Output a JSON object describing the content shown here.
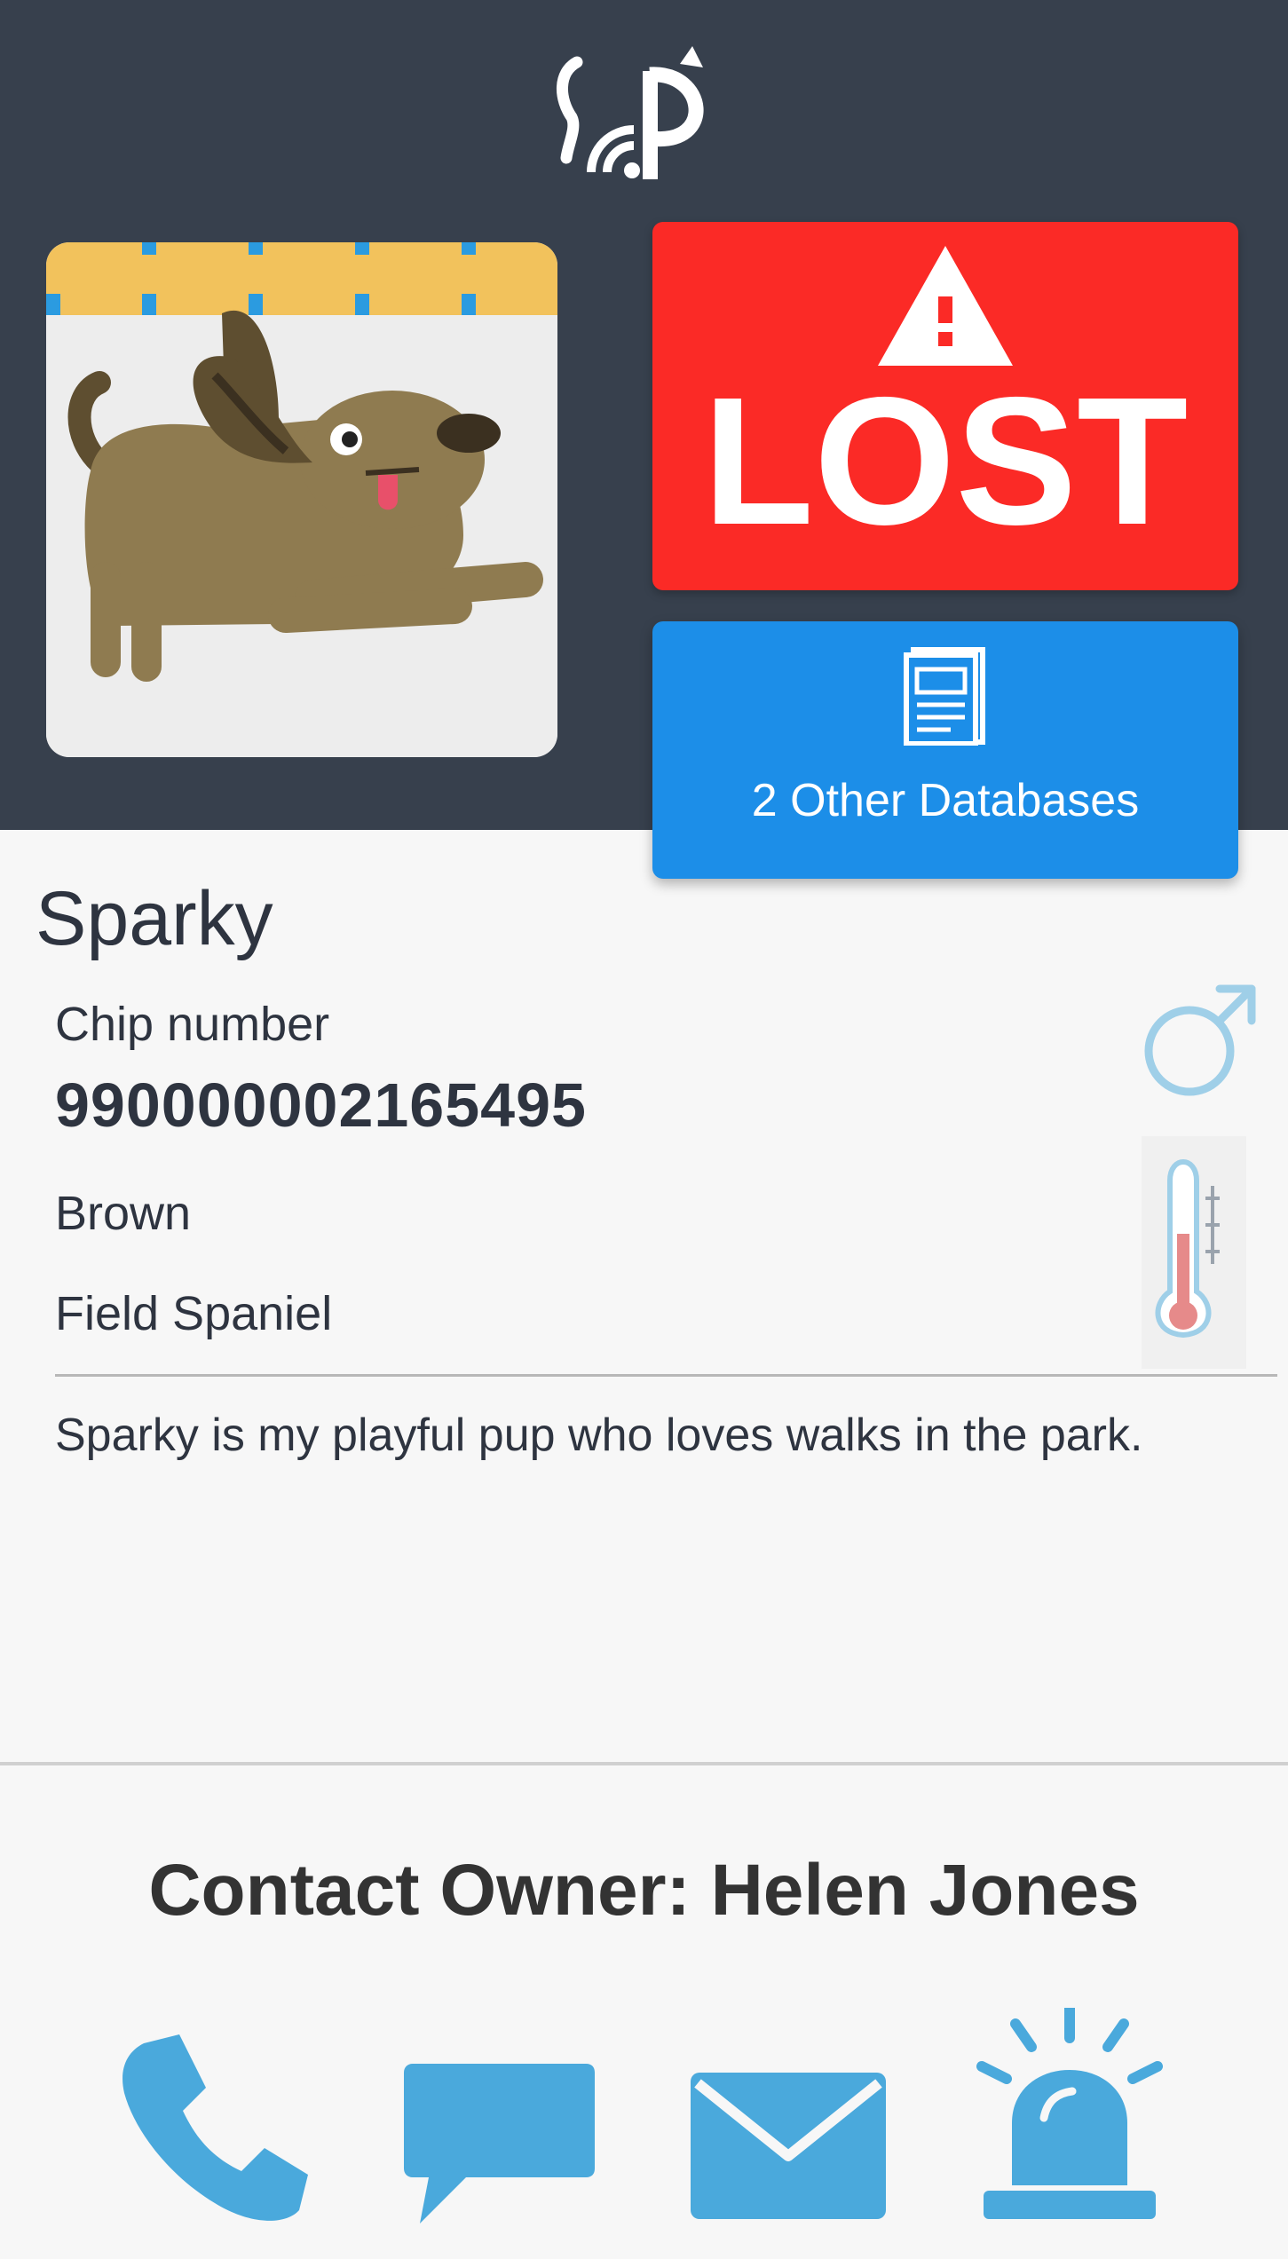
{
  "header": {
    "logo_icon": "cat-wifi-logo-icon"
  },
  "status": {
    "lost_label": "LOST",
    "lost_icon": "warning-triangle-icon",
    "lost_color": "#fb2a26",
    "databases_label": "2 Other Databases",
    "databases_icon": "document-icon",
    "databases_color": "#1c8ee8"
  },
  "pet": {
    "photo_icon": "dog-illustration",
    "name": "Sparky",
    "chip_label": "Chip number",
    "chip_number": "990000002165495",
    "color": "Brown",
    "breed": "Field Spaniel",
    "description": "Sparky is my playful pup who loves walks in the park.",
    "sex_icon": "male-icon",
    "condition_icon": "thermometer-icon"
  },
  "contact": {
    "heading": "Contact Owner: Helen Jones",
    "actions": [
      {
        "name": "phone",
        "icon": "phone-icon"
      },
      {
        "name": "message",
        "icon": "chat-bubble-icon"
      },
      {
        "name": "email",
        "icon": "envelope-icon"
      },
      {
        "name": "alarm",
        "icon": "siren-icon"
      }
    ],
    "accent_color": "#4aa9dc"
  },
  "theme": {
    "header_bg": "#37404d",
    "page_bg": "#f7f7f7",
    "text": "#2e3440"
  }
}
